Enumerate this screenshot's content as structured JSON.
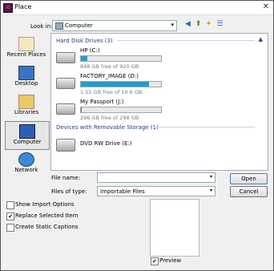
{
  "title": "Place",
  "app_icon_text": "Id",
  "look_in": {
    "label": "Look in:",
    "value": "Computer"
  },
  "places": [
    {
      "label": "Recent Places"
    },
    {
      "label": "Desktop"
    },
    {
      "label": "Libraries"
    },
    {
      "label": "Computer"
    },
    {
      "label": "Network"
    }
  ],
  "groups": {
    "hdd": "Hard Disk Drives (3)",
    "removable": "Devices with Removable Storage (1)"
  },
  "drives": [
    {
      "name": "HP (C:)",
      "free": "848 GB free of 920 GB",
      "used_fraction": 0.08
    },
    {
      "name": "FACTORY_IMAGE (D:)",
      "free": "1.55 GB free of 10.6 GB",
      "used_fraction": 0.85
    },
    {
      "name": "My Passport (J:)",
      "free": "296 GB free of 298 GB",
      "used_fraction": 0.01
    }
  ],
  "removable_drive": {
    "name": "DVD RW Drive (E:)"
  },
  "file_name": {
    "label": "File name:",
    "value": ""
  },
  "files_of_type": {
    "label": "Files of type:",
    "value": "Importable Files"
  },
  "buttons": {
    "open": "Open",
    "cancel": "Cancel"
  },
  "options": [
    {
      "label": "Show Import Options",
      "checked": false
    },
    {
      "label": "Replace Selected Item",
      "checked": true
    },
    {
      "label": "Create Static Captions",
      "checked": false
    }
  ],
  "preview": {
    "label": "Preview",
    "checked": true
  }
}
